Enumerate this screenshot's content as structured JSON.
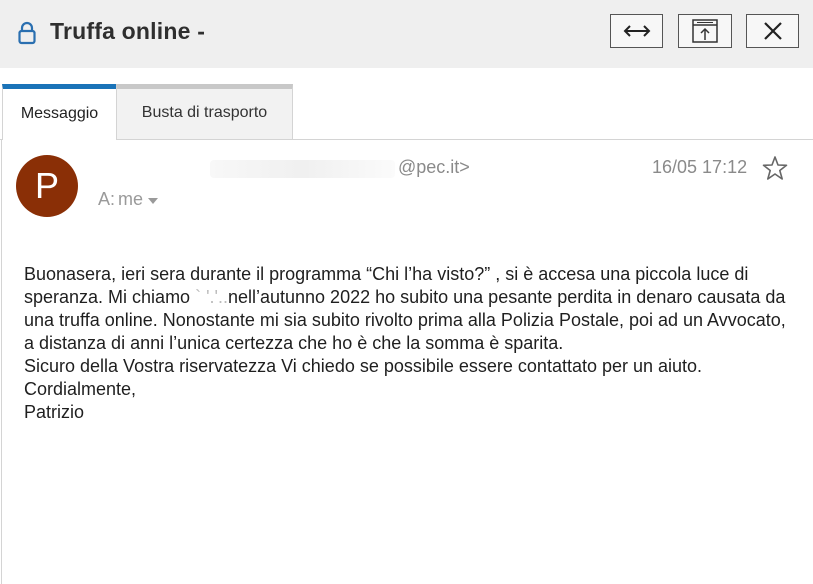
{
  "window": {
    "title": "Truffa online -",
    "icons": [
      "lock-icon",
      "expand-horizontal-icon",
      "popout-window-icon",
      "close-icon"
    ]
  },
  "tabs": [
    {
      "label": "Messaggio",
      "active": true
    },
    {
      "label": "Busta di trasporto",
      "active": false
    }
  ],
  "message": {
    "avatar_letter": "P",
    "avatar_color": "#8a2f06",
    "sender": "@pec.it>",
    "date": "16/05 17:12",
    "to_label": "A:",
    "to_value": "me",
    "body": {
      "line1": "Buonasera, ieri sera durante il programma “Chi l’ha visto?” , si è accesa una piccola luce di speranza. Mi chiamo",
      "line1b": "nell’autunno 2022 ho subito una pesante perdita in denaro causata da una truffa online. Nonostante mi sia subito rivolto prima alla Polizia Postale, poi ad un Avvocato, a distanza di anni l’unica certezza che ho è che la somma è sparita.",
      "line2": "Sicuro della Vostra riservatezza Vi chiedo se possibile essere contattato per un aiuto.",
      "line3": "Cordialmente,",
      "line4": "Patrizio"
    }
  },
  "colors": {
    "accent_tab": "#1a73b8",
    "titlebar_bg": "#efefef",
    "meta_text": "#8a8a8a"
  }
}
